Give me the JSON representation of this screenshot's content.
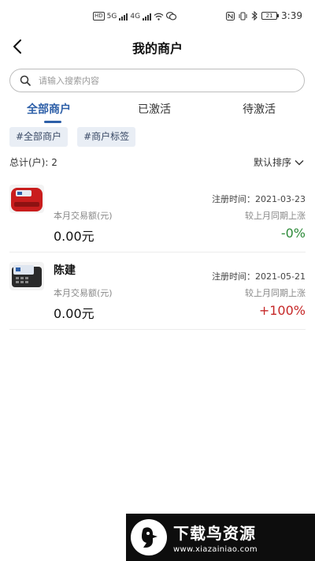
{
  "status_bar": {
    "hd": "HD",
    "net1": "5G",
    "net2": "4G",
    "battery": "21",
    "time": "3:39"
  },
  "header": {
    "title": "我的商户"
  },
  "search": {
    "placeholder": "请输入搜索内容"
  },
  "tabs": [
    {
      "label": "全部商户",
      "active": true
    },
    {
      "label": "已激活",
      "active": false
    },
    {
      "label": "待激活",
      "active": false
    }
  ],
  "tags": [
    "#全部商户",
    "#商户标签"
  ],
  "summary": {
    "count_label": "总计(户):",
    "count": "2",
    "sort_label": "默认排序"
  },
  "merchants": [
    {
      "name": "",
      "reg_time": "注册时间：2021-03-23",
      "month_label": "本月交易额(元)",
      "amount": "0.00元",
      "compare_label": "较上月同期上涨",
      "change": "-0%"
    },
    {
      "name": "陈建",
      "reg_time": "注册时间：2021-05-21",
      "month_label": "本月交易额(元)",
      "amount": "0.00元",
      "compare_label": "较上月同期上涨",
      "change": "+100%"
    }
  ],
  "watermark": {
    "title": "下载鸟资源",
    "url": "www.xiazainiao.com"
  },
  "colors": {
    "accent": "#2d5fa8",
    "positive": "#c62828",
    "neutral": "#2e8b3a"
  }
}
